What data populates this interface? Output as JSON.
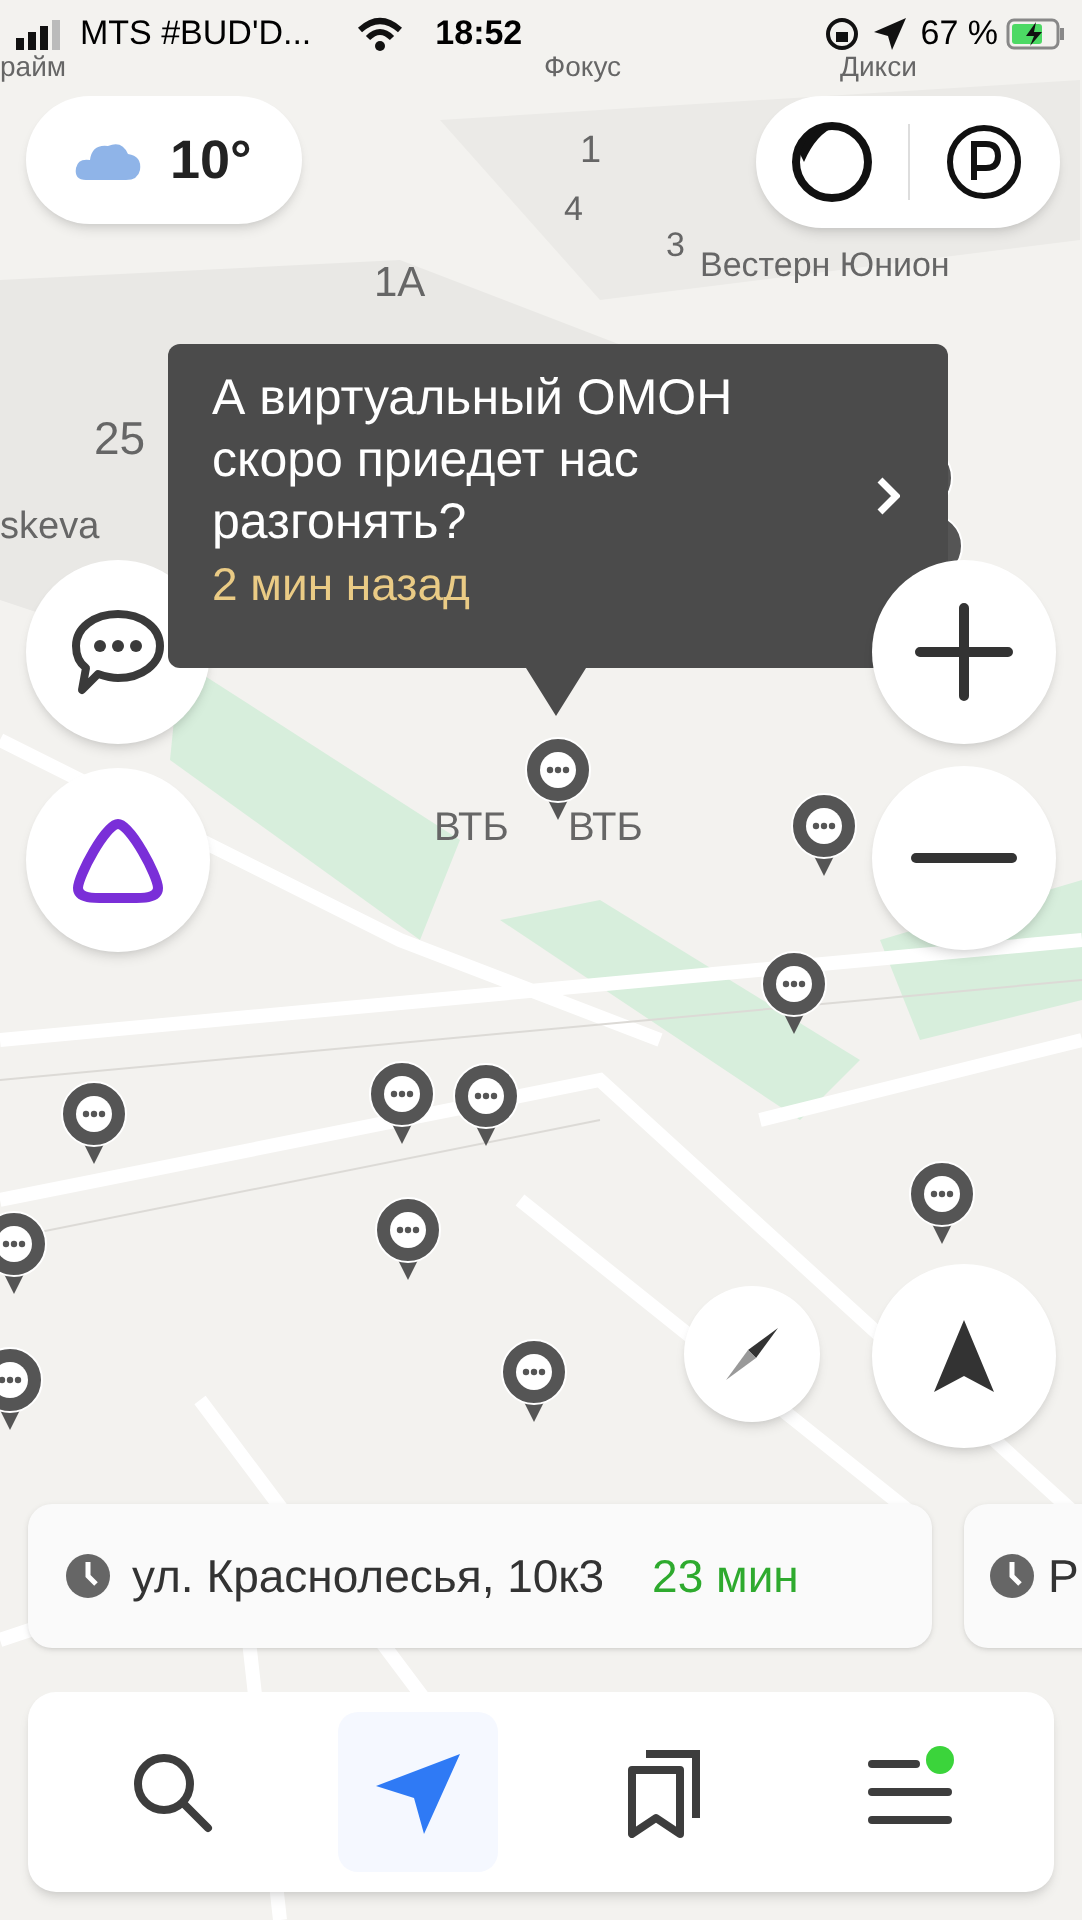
{
  "status_bar": {
    "carrier": "MTS #BUD'D...",
    "time": "18:52",
    "battery": "67 %"
  },
  "map": {
    "labels": [
      {
        "text": "райм"
      },
      {
        "text": "Фокус"
      },
      {
        "text": "Дикси"
      },
      {
        "text": "1"
      },
      {
        "text": "4"
      },
      {
        "text": "3"
      },
      {
        "text": "Вестерн Юнион"
      },
      {
        "text": "1А"
      },
      {
        "text": "25"
      },
      {
        "text": "skeva"
      },
      {
        "text": "ВТБ"
      },
      {
        "text": "ВТБ"
      }
    ]
  },
  "weather": {
    "temperature": "10°"
  },
  "popup": {
    "message": "А виртуальный ОМОН скоро приедет нас разгонять?",
    "time": "2 мин назад"
  },
  "destinations": [
    {
      "address": "ул. Краснолесья, 10к3",
      "eta": "23 мин"
    },
    {
      "address": "Р"
    }
  ],
  "nav": [
    {
      "kind": "search",
      "selected": false,
      "badge": false
    },
    {
      "kind": "route",
      "selected": true,
      "badge": false
    },
    {
      "kind": "bookmarks",
      "selected": false,
      "badge": false
    },
    {
      "kind": "menu",
      "selected": false,
      "badge": true
    }
  ]
}
